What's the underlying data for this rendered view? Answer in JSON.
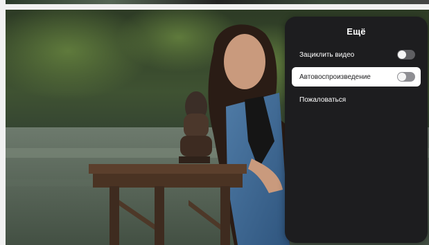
{
  "menu": {
    "title": "Ещё",
    "items": [
      {
        "label": "Зациклить видео",
        "toggle": "off"
      },
      {
        "label": "Автовоспроизведение",
        "toggle": "off",
        "highlighted": true
      },
      {
        "label": "Пожаловаться"
      }
    ]
  },
  "colors": {
    "panel_background": "#1d1d1f",
    "highlight_background": "#ffffff",
    "toggle_off_track": "#5f5f62"
  },
  "icons": {
    "toggle_off": "toggle-switch-off"
  }
}
